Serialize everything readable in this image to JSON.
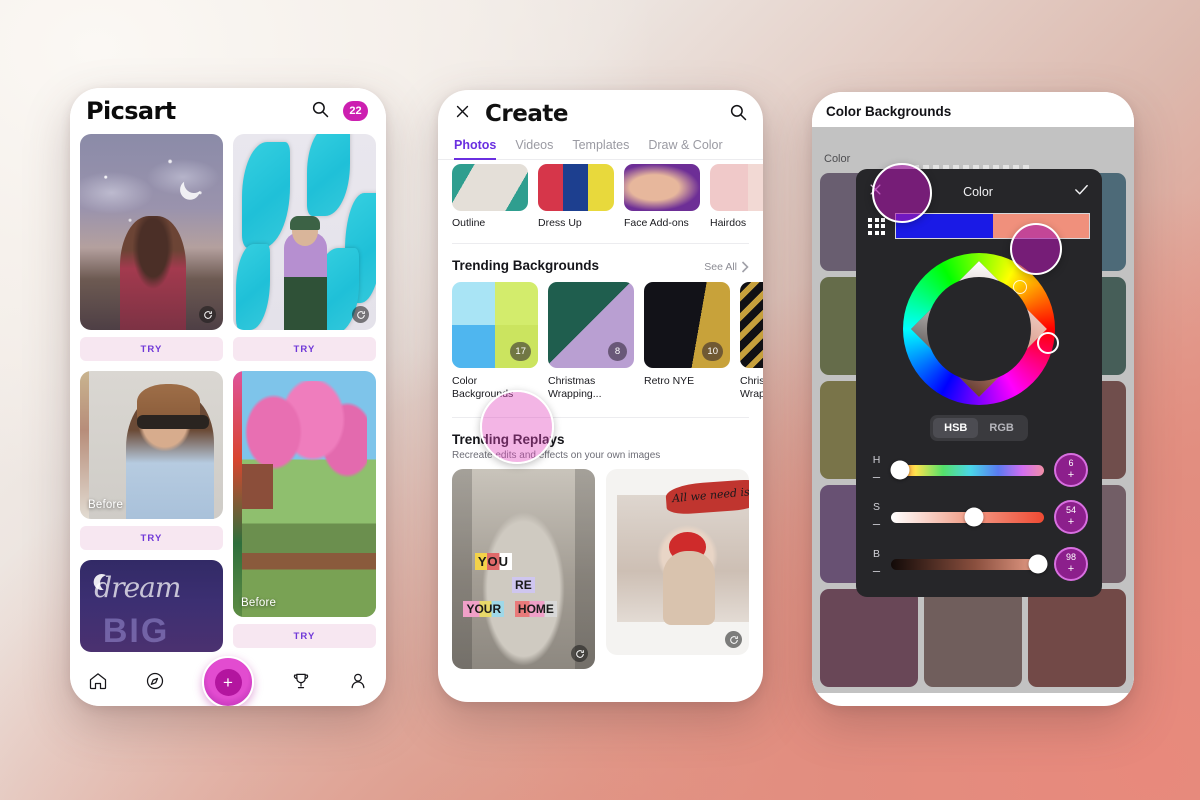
{
  "background": {
    "top_left": "#f7f3ef",
    "bottom_right": "#e48b7b"
  },
  "phone_home": {
    "logo": "Picsart",
    "search_icon": "search-icon",
    "notification_count": "22",
    "try_label": "TRY",
    "before_label": "Before",
    "cards": [
      {
        "id": "night-sky",
        "try": "TRY",
        "before": "",
        "replay": true
      },
      {
        "id": "teal-flames",
        "try": "TRY",
        "before": "",
        "replay": true
      },
      {
        "id": "hat-girl",
        "try": "TRY",
        "before": "Before",
        "replay": false
      },
      {
        "id": "pink-tree",
        "try": "TRY",
        "before": "Before",
        "replay": false
      },
      {
        "id": "dream-big",
        "try": "",
        "before": "",
        "replay": false
      }
    ],
    "nav": [
      {
        "name": "home-icon",
        "label": "Home"
      },
      {
        "name": "discover-icon",
        "label": "Discover"
      },
      {
        "name": "create-fab",
        "label": "+"
      },
      {
        "name": "challenges-icon",
        "label": "Challenges"
      },
      {
        "name": "profile-icon",
        "label": "Profile"
      }
    ],
    "fab_label": "+"
  },
  "phone_create": {
    "close_icon": "close-icon",
    "title": "Create",
    "search_icon": "search-icon",
    "tabs": [
      {
        "label": "Photos",
        "active": true
      },
      {
        "label": "Videos",
        "active": false
      },
      {
        "label": "Templates",
        "active": false
      },
      {
        "label": "Draw & Color",
        "active": false
      }
    ],
    "categories": [
      {
        "label": "Outline"
      },
      {
        "label": "Dress Up"
      },
      {
        "label": "Face Add-ons"
      },
      {
        "label": "Hairdos"
      }
    ],
    "trending_backgrounds": {
      "title": "Trending Backgrounds",
      "see_all": "See All",
      "items": [
        {
          "label": "Color Backgrounds",
          "count": "17"
        },
        {
          "label": "Christmas Wrapping...",
          "count": "8"
        },
        {
          "label": "Retro NYE",
          "count": "10"
        },
        {
          "label": "Christmas Gift Wrap",
          "count": ""
        }
      ]
    },
    "trending_replays": {
      "title": "Trending Replays",
      "subtitle": "Recreate edits and effects on your own images",
      "items": [
        {
          "id": "you-are-your-home",
          "text": "YOU ARE YOUR HOME"
        },
        {
          "id": "all-we-need-is-love",
          "text": "All we need is Love"
        }
      ]
    }
  },
  "phone_color": {
    "screen_title": "Color Backgrounds",
    "section_label": "Color",
    "swatches": [
      "#5d4a6b",
      "#8f8f92",
      "#2a5f78",
      "#566326",
      "#707a2e",
      "#1e4a3f",
      "#7a7223",
      "#8a8133",
      "#6b2d28",
      "#5c3270",
      "#3b1470",
      "#6e4a58",
      "#5e1f3d",
      "#6b4a46",
      "#6e2420"
    ],
    "modal": {
      "close_icon": "close-icon",
      "title": "Color",
      "confirm_icon": "check-icon",
      "palette_icon": "grid-icon",
      "swatch_left": "#1a1ae6",
      "swatch_right": "#f0907c",
      "mode_options": [
        {
          "label": "HSB",
          "active": true
        },
        {
          "label": "RGB",
          "active": false
        }
      ],
      "sliders": [
        {
          "label": "H",
          "value": "6",
          "plus": "+",
          "minus": "–",
          "pct": 6
        },
        {
          "label": "S",
          "value": "54",
          "plus": "+",
          "minus": "–",
          "pct": 54
        },
        {
          "label": "B",
          "value": "98",
          "plus": "+",
          "minus": "–",
          "pct": 98
        }
      ]
    }
  }
}
